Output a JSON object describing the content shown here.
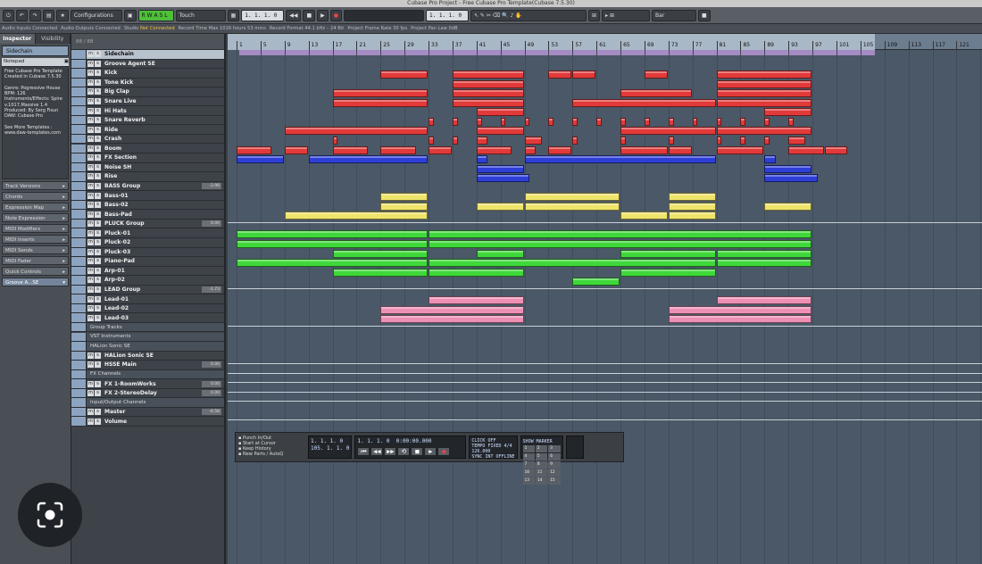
{
  "window": {
    "title": "Cubase Pro Project - Free Cubase Pro Template(Cubase 7.5.30)"
  },
  "toolbar": {
    "configurations": "Configurations",
    "automation_mode": "Touch",
    "position_primary": "1. 1. 1. 0",
    "position_secondary": "105. 1. 1. 0",
    "position_right": "1. 1. 1. 0",
    "time_right": "0:00:00.000",
    "snap": "Bar",
    "monitor_letters": [
      "R",
      "W",
      "A",
      "S",
      "L"
    ]
  },
  "infobar": [
    {
      "label": "Audio Inputs",
      "value": "Connected"
    },
    {
      "label": "Audio Outputs",
      "value": "Connected"
    },
    {
      "label": "Studio",
      "value": "Not Connected"
    },
    {
      "label": "Record Time Max",
      "value": "1016 hours 53 mins"
    },
    {
      "label": "Record Format",
      "value": "44.1 kHz – 24 Bit"
    },
    {
      "label": "Project Frame Rate",
      "value": "30 fps"
    },
    {
      "label": "Project Pan Law",
      "value": "0dB"
    }
  ],
  "inspector": {
    "tabs": [
      "Inspector",
      "Visibility"
    ],
    "track_name": "Sidechain",
    "notepad_label": "Notepad",
    "notepad_lines": [
      "Free Cubase Pro Template",
      "Created in Cubase 7.5.30",
      "",
      "Genre: Pogressive House",
      "BPM: 126",
      "Instruments/Effects: Spire",
      "v.1017,Massive 1.4",
      "Produced: By Serg Fisun",
      "DAW: Cubase Pro",
      "",
      "See More Templates :",
      "www.daw-templates.com"
    ],
    "sections": [
      "Track Versions",
      "Chords",
      "Expression Map",
      "Note Expression",
      "MIDI Modifiers",
      "MIDI Inserts",
      "MIDI Sends",
      "MIDI Fader",
      "Quick Controls"
    ],
    "preset": "Groove A...SE"
  },
  "tracklist": {
    "header": "88 / 88",
    "tracks": [
      {
        "name": "Sidechain",
        "vol": "",
        "sel": true
      },
      {
        "name": "Groove Agent SE",
        "vol": ""
      },
      {
        "name": "Kick",
        "vol": ""
      },
      {
        "name": "Tone Kick",
        "vol": ""
      },
      {
        "name": "Big Clap",
        "vol": ""
      },
      {
        "name": "Snare Live",
        "vol": ""
      },
      {
        "name": "Hi Hats",
        "vol": ""
      },
      {
        "name": "Snare Reverb",
        "vol": ""
      },
      {
        "name": "Ride",
        "vol": ""
      },
      {
        "name": "Crash",
        "vol": ""
      },
      {
        "name": "Boom",
        "vol": ""
      },
      {
        "name": "FX Section",
        "vol": ""
      },
      {
        "name": "Noise SH",
        "vol": ""
      },
      {
        "name": "Rise",
        "vol": ""
      },
      {
        "name": "BASS Group",
        "vol": "-2.98"
      },
      {
        "name": "Bass-01",
        "vol": ""
      },
      {
        "name": "Bass-02",
        "vol": ""
      },
      {
        "name": "Bass-Pad",
        "vol": ""
      },
      {
        "name": "PLUCK Group",
        "vol": "0.00"
      },
      {
        "name": "Pluck-01",
        "vol": ""
      },
      {
        "name": "Pluck-02",
        "vol": ""
      },
      {
        "name": "Pluck-03",
        "vol": ""
      },
      {
        "name": "Piano-Pad",
        "vol": ""
      },
      {
        "name": "Arp-01",
        "vol": ""
      },
      {
        "name": "Arp-02",
        "vol": ""
      },
      {
        "name": "LEAD Group",
        "vol": "-1.73"
      },
      {
        "name": "Lead-01",
        "vol": ""
      },
      {
        "name": "Lead-02",
        "vol": ""
      },
      {
        "name": "Lead-03",
        "vol": ""
      },
      {
        "name": "Group Tracks",
        "vol": "",
        "folder": true
      },
      {
        "name": "VST Instruments",
        "vol": "",
        "folder": true
      },
      {
        "name": "HALion Sonic SE",
        "vol": "",
        "folder": true
      },
      {
        "name": "HALion Sonic SE",
        "vol": ""
      },
      {
        "name": "HSSE Main",
        "vol": "0.00"
      },
      {
        "name": "FX Channels",
        "vol": "",
        "folder": true
      },
      {
        "name": "FX 1-RoomWorks",
        "vol": "0.00"
      },
      {
        "name": "FX 2-StereoDelay",
        "vol": "0.00"
      },
      {
        "name": "Input/Output Channels",
        "vol": "",
        "folder": true
      },
      {
        "name": "Master",
        "vol": "-6.58"
      },
      {
        "name": "Volume",
        "vol": ""
      }
    ]
  },
  "ruler": {
    "bars": [
      "1",
      "5",
      "9",
      "13",
      "17",
      "21",
      "25",
      "29",
      "33",
      "37",
      "41",
      "45",
      "49",
      "53",
      "57",
      "61",
      "65",
      "69",
      "73",
      "77",
      "81",
      "85",
      "89",
      "93",
      "97",
      "101",
      "105",
      "109",
      "113",
      "117",
      "121"
    ]
  },
  "colors": {
    "drums": "#e23a3a",
    "fx": "#2e3fd8",
    "bass": "#efe46a",
    "pluck": "#3fd83a",
    "lead": "#ee8fb4",
    "loop": "#a58bc4"
  },
  "events": [
    {
      "row": 2,
      "c": "drums",
      "spans": [
        [
          25,
          33
        ],
        [
          37,
          49
        ],
        [
          53,
          57
        ],
        [
          57,
          61
        ],
        [
          69,
          73
        ],
        [
          81,
          97
        ]
      ]
    },
    {
      "row": 3,
      "c": "drums",
      "spans": [
        [
          37,
          49
        ],
        [
          81,
          97
        ]
      ]
    },
    {
      "row": 4,
      "c": "drums",
      "spans": [
        [
          17,
          33
        ],
        [
          37,
          49
        ],
        [
          65,
          77
        ],
        [
          81,
          97
        ]
      ]
    },
    {
      "row": 5,
      "c": "drums",
      "spans": [
        [
          17,
          33
        ],
        [
          37,
          49
        ],
        [
          57,
          81
        ],
        [
          81,
          97
        ]
      ]
    },
    {
      "row": 6,
      "c": "drums",
      "spans": [
        [
          41,
          49
        ],
        [
          89,
          97
        ]
      ]
    },
    {
      "row": 7,
      "c": "drums",
      "spans": [
        [
          33,
          34
        ],
        [
          37,
          38
        ],
        [
          41,
          42
        ],
        [
          45,
          46
        ],
        [
          49,
          50
        ],
        [
          53,
          54
        ],
        [
          57,
          58
        ],
        [
          61,
          62
        ],
        [
          65,
          66
        ],
        [
          69,
          70
        ],
        [
          73,
          74
        ],
        [
          77,
          78
        ],
        [
          81,
          82
        ],
        [
          85,
          86
        ],
        [
          89,
          90
        ],
        [
          93,
          94
        ]
      ]
    },
    {
      "row": 8,
      "c": "drums",
      "spans": [
        [
          9,
          33
        ],
        [
          41,
          49
        ],
        [
          65,
          81
        ],
        [
          81,
          97
        ]
      ]
    },
    {
      "row": 9,
      "c": "drums",
      "spans": [
        [
          17,
          18
        ],
        [
          33,
          34
        ],
        [
          37,
          38
        ],
        [
          41,
          43
        ],
        [
          49,
          52
        ],
        [
          57,
          58
        ],
        [
          65,
          66
        ],
        [
          73,
          74
        ],
        [
          81,
          82
        ],
        [
          85,
          86
        ],
        [
          89,
          90
        ],
        [
          93,
          96
        ]
      ]
    },
    {
      "row": 10,
      "c": "drums",
      "spans": [
        [
          1,
          7
        ],
        [
          9,
          13
        ],
        [
          17,
          23
        ],
        [
          25,
          31
        ],
        [
          33,
          37
        ],
        [
          41,
          47
        ],
        [
          49,
          51
        ],
        [
          53,
          57
        ],
        [
          65,
          73
        ],
        [
          73,
          77
        ],
        [
          81,
          89
        ],
        [
          93,
          99
        ],
        [
          99,
          103
        ]
      ]
    },
    {
      "row": 11,
      "c": "fx",
      "spans": [
        [
          1,
          9
        ],
        [
          13,
          33
        ],
        [
          41,
          43
        ],
        [
          49,
          81
        ],
        [
          89,
          91
        ]
      ]
    },
    {
      "row": 12,
      "c": "fx",
      "spans": [
        [
          41,
          49
        ],
        [
          89,
          97
        ]
      ]
    },
    {
      "row": 13,
      "c": "fx",
      "spans": [
        [
          41,
          50
        ],
        [
          89,
          98
        ]
      ]
    },
    {
      "row": 15,
      "c": "bass",
      "spans": [
        [
          25,
          33
        ],
        [
          49,
          65
        ],
        [
          73,
          81
        ]
      ]
    },
    {
      "row": 16,
      "c": "bass",
      "spans": [
        [
          25,
          33
        ],
        [
          41,
          49
        ],
        [
          49,
          65
        ],
        [
          73,
          81
        ],
        [
          89,
          97
        ]
      ]
    },
    {
      "row": 17,
      "c": "bass",
      "spans": [
        [
          9,
          33
        ],
        [
          65,
          73
        ],
        [
          73,
          81
        ]
      ]
    },
    {
      "row": 19,
      "c": "pluck",
      "spans": [
        [
          1,
          33
        ],
        [
          33,
          97
        ]
      ]
    },
    {
      "row": 20,
      "c": "pluck",
      "spans": [
        [
          1,
          33
        ],
        [
          33,
          97
        ]
      ]
    },
    {
      "row": 21,
      "c": "pluck",
      "spans": [
        [
          17,
          33
        ],
        [
          41,
          49
        ],
        [
          65,
          81
        ],
        [
          81,
          97
        ]
      ]
    },
    {
      "row": 22,
      "c": "pluck",
      "spans": [
        [
          1,
          33
        ],
        [
          33,
          81
        ],
        [
          81,
          97
        ]
      ]
    },
    {
      "row": 23,
      "c": "pluck",
      "spans": [
        [
          17,
          33
        ],
        [
          33,
          49
        ],
        [
          65,
          81
        ]
      ]
    },
    {
      "row": 24,
      "c": "pluck",
      "spans": [
        [
          57,
          65
        ]
      ]
    },
    {
      "row": 26,
      "c": "lead",
      "spans": [
        [
          33,
          49
        ],
        [
          81,
          97
        ]
      ]
    },
    {
      "row": 27,
      "c": "lead",
      "spans": [
        [
          25,
          49
        ],
        [
          73,
          97
        ]
      ]
    },
    {
      "row": 28,
      "c": "lead",
      "spans": [
        [
          25,
          49
        ],
        [
          73,
          97
        ]
      ]
    }
  ],
  "transport": {
    "options": [
      "Punch In/Out",
      "Start at Cursor",
      "Keep History",
      "New Parts / AutoQ"
    ],
    "left_locator": "1. 1. 1. 0",
    "right_locator": "105. 1. 1. 0",
    "position_bars": "1. 1. 1. 0",
    "position_time": "0:00:00.000",
    "tempo": "126.000",
    "signature": "4/4",
    "click_label": "CLICK",
    "click_value": "OFF",
    "tempo_label": "TEMPO",
    "tempo_mode": "FIXED",
    "sync_label": "SYNC",
    "sync_value": "INT",
    "sync_state": "OFFLINE",
    "show_label": "SHOW",
    "show_value": "MARKER",
    "markers": [
      "1",
      "2",
      "3",
      "4",
      "5",
      "6",
      "7",
      "8",
      "9",
      "10",
      "11",
      "12",
      "13",
      "14",
      "15"
    ]
  }
}
